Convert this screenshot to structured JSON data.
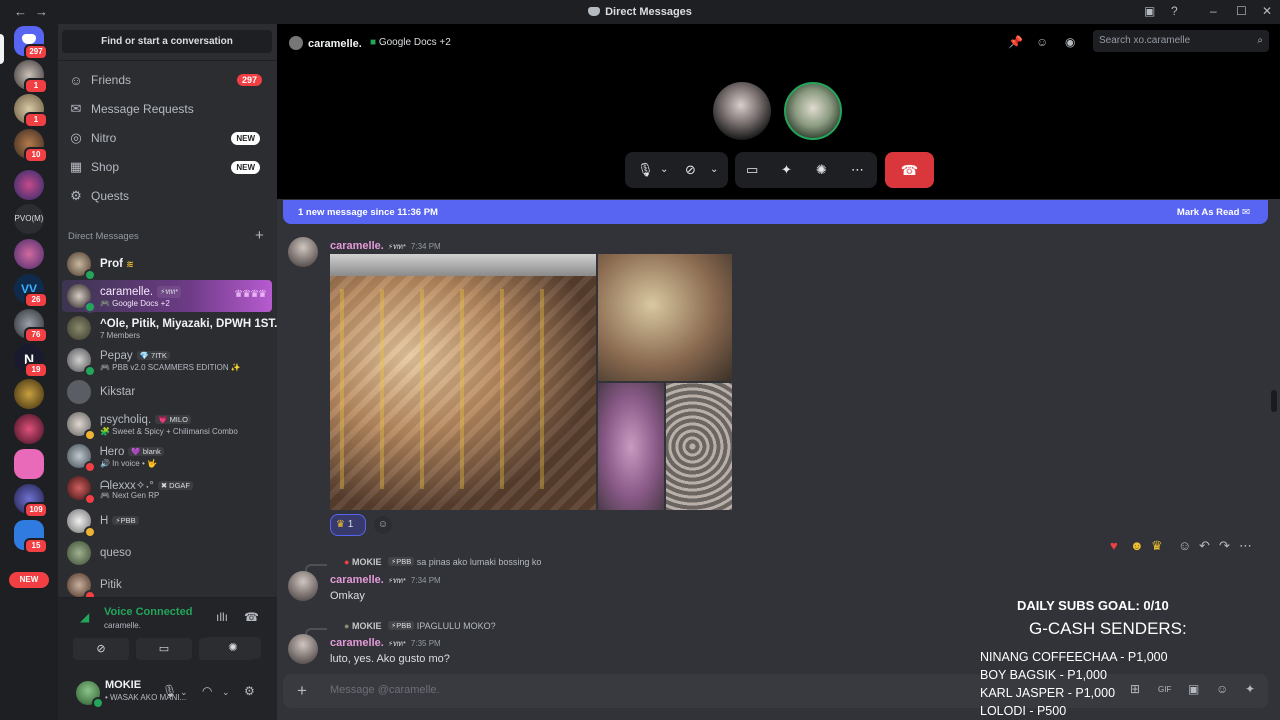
{
  "window": {
    "title": "Direct Messages",
    "back": "←",
    "forward": "→"
  },
  "guilds": {
    "home_badge": "297",
    "items": [
      {
        "badge": "1"
      },
      {
        "badge": "1"
      },
      {
        "badge": "10"
      },
      {
        "badge": ""
      },
      {
        "label": "PVO(M)"
      },
      {
        "badge": ""
      },
      {
        "badge": "26"
      },
      {
        "badge": "76"
      },
      {
        "badge": "19"
      },
      {
        "badge": ""
      },
      {
        "badge": ""
      },
      {
        "badge": ""
      },
      {
        "badge": "109"
      },
      {
        "badge": "15"
      }
    ],
    "new_label": "NEW"
  },
  "sidebar": {
    "find_label": "Find or start a conversation",
    "nav": [
      {
        "label": "Friends",
        "badge": "297",
        "icon": "friends-icon"
      },
      {
        "label": "Message Requests",
        "icon": "mail-icon"
      },
      {
        "label": "Nitro",
        "badge": "NEW",
        "icon": "nitro-icon"
      },
      {
        "label": "Shop",
        "badge": "NEW",
        "icon": "shop-icon"
      },
      {
        "label": "Quests",
        "icon": "quests-icon"
      }
    ],
    "dm_header": "Direct Messages",
    "dms": [
      {
        "name": "Prof",
        "status": "online"
      },
      {
        "name": "caramelle.",
        "tag": "⚡ทท*",
        "sub": "🎮 Google Docs +2",
        "status": "online",
        "active": true
      },
      {
        "name": "^Ole, Pitik, Miyazaki, DPWH 1ST...",
        "sub": "7 Members"
      },
      {
        "name": "Pepay",
        "tag": "💎 7ITK",
        "sub": "🎮 PBB v2.0 SCAMMERS EDITION ✨",
        "status": "online"
      },
      {
        "name": "Kikstar"
      },
      {
        "name": "psycholiq.",
        "tag": "💗 MILO",
        "sub": "🧩 Sweet & Spicy + Chilimansi Combo",
        "status": "idle"
      },
      {
        "name": "Ꮋero",
        "tag": "💜 blank",
        "sub": "🔊 In voice • 🤟",
        "status": "dnd"
      },
      {
        "name": "ᗩlexxx✧˖°",
        "tag": "✖ DGAF",
        "sub": "🎮 Next Gen RP",
        "status": "dnd"
      },
      {
        "name": "H",
        "tag": "⚡PBB",
        "status": "idle"
      },
      {
        "name": "queso"
      },
      {
        "name": "Pitik",
        "status": "dnd"
      }
    ]
  },
  "voice": {
    "status": "Voice Connected",
    "channel": "caramelle."
  },
  "user": {
    "name": "MOKIE",
    "status": "• WASAK AKO MANI..."
  },
  "call": {
    "name": "caramelle.",
    "activity": "Google Docs +2",
    "search_placeholder": "Search xo.caramelle"
  },
  "banner": {
    "text": "1 new message since 11:36 PM",
    "action": "Mark As Read"
  },
  "messages": [
    {
      "author": "caramelle.",
      "tag": "⚡ทท*",
      "time": "7:34 PM",
      "reaction_count": "1"
    },
    {
      "reply_author": "MOKIE",
      "reply_tag": "⚡PBB",
      "reply_text": "sa pinas ako lumaki bossing ko",
      "author": "caramelle.",
      "tag": "⚡ทท*",
      "time": "7:34 PM",
      "text": "Omkay"
    },
    {
      "reply_author": "MOKIE",
      "reply_tag": "⚡PBB",
      "reply_text": "IPAGLULU MOKO?",
      "author": "caramelle.",
      "tag": "⚡ทท*",
      "time": "7:35 PM",
      "text": "luto, yes. Ako gusto mo?"
    }
  ],
  "composer": {
    "placeholder": "Message @caramelle."
  },
  "overlay": {
    "goal": "DAILY SUBS GOAL: 0/10",
    "heading": "G-CASH SENDERS:",
    "senders": [
      "NINANG COFFEECHAA - P1,000",
      "BOY BAGSIK - P1,000",
      "KARL JASPER - P1,000",
      "LOLODI - P500"
    ]
  },
  "colors": {
    "accent": "#5865f2",
    "online": "#23a55a",
    "danger": "#da373c",
    "badge": "#f23f43"
  }
}
